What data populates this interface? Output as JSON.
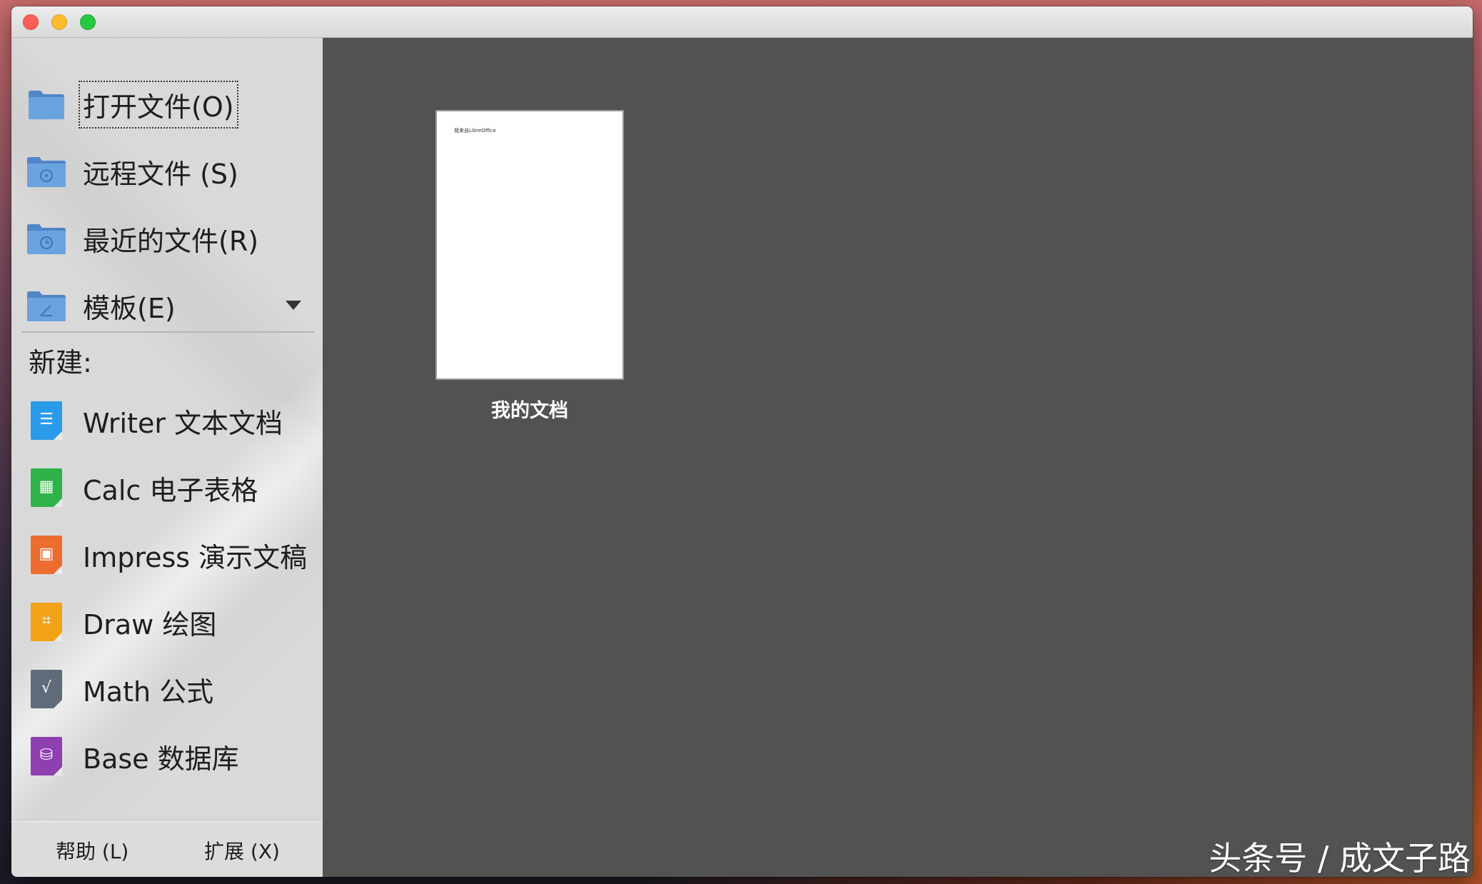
{
  "window": {
    "traffic_lights": [
      "close",
      "minimize",
      "maximize"
    ]
  },
  "sidebar": {
    "actions": [
      {
        "label": "打开文件(O)",
        "icon": "folder-icon"
      },
      {
        "label": "远程文件 (S)",
        "icon": "remote-folder-icon"
      },
      {
        "label": "最近的文件(R)",
        "icon": "recent-folder-icon"
      },
      {
        "label": "模板(E)",
        "icon": "template-folder-icon"
      }
    ],
    "new_title": "新建:",
    "new_items": [
      {
        "label": "Writer 文本文档",
        "icon": "writer-icon",
        "color": "#2a9be8"
      },
      {
        "label": "Calc 电子表格",
        "icon": "calc-icon",
        "color": "#2fb24a"
      },
      {
        "label": "Impress 演示文稿",
        "icon": "impress-icon",
        "color": "#ed6c30"
      },
      {
        "label": "Draw 绘图",
        "icon": "draw-icon",
        "color": "#f2a216"
      },
      {
        "label": "Math 公式",
        "icon": "math-icon",
        "color": "#5f6b78"
      },
      {
        "label": "Base 数据库",
        "icon": "base-icon",
        "color": "#8e3fb0"
      }
    ],
    "help_label": "帮助 (L)",
    "extensions_label": "扩展 (X)"
  },
  "recent_documents": [
    {
      "title": "我的文档",
      "preview_text": "我来自LibreOffice"
    }
  ],
  "watermark": "头条号 / 成文子路",
  "colors": {
    "main_background": "#525252",
    "sidebar_background": "#d9d9d9",
    "folder_blue": "#5b95d6"
  }
}
